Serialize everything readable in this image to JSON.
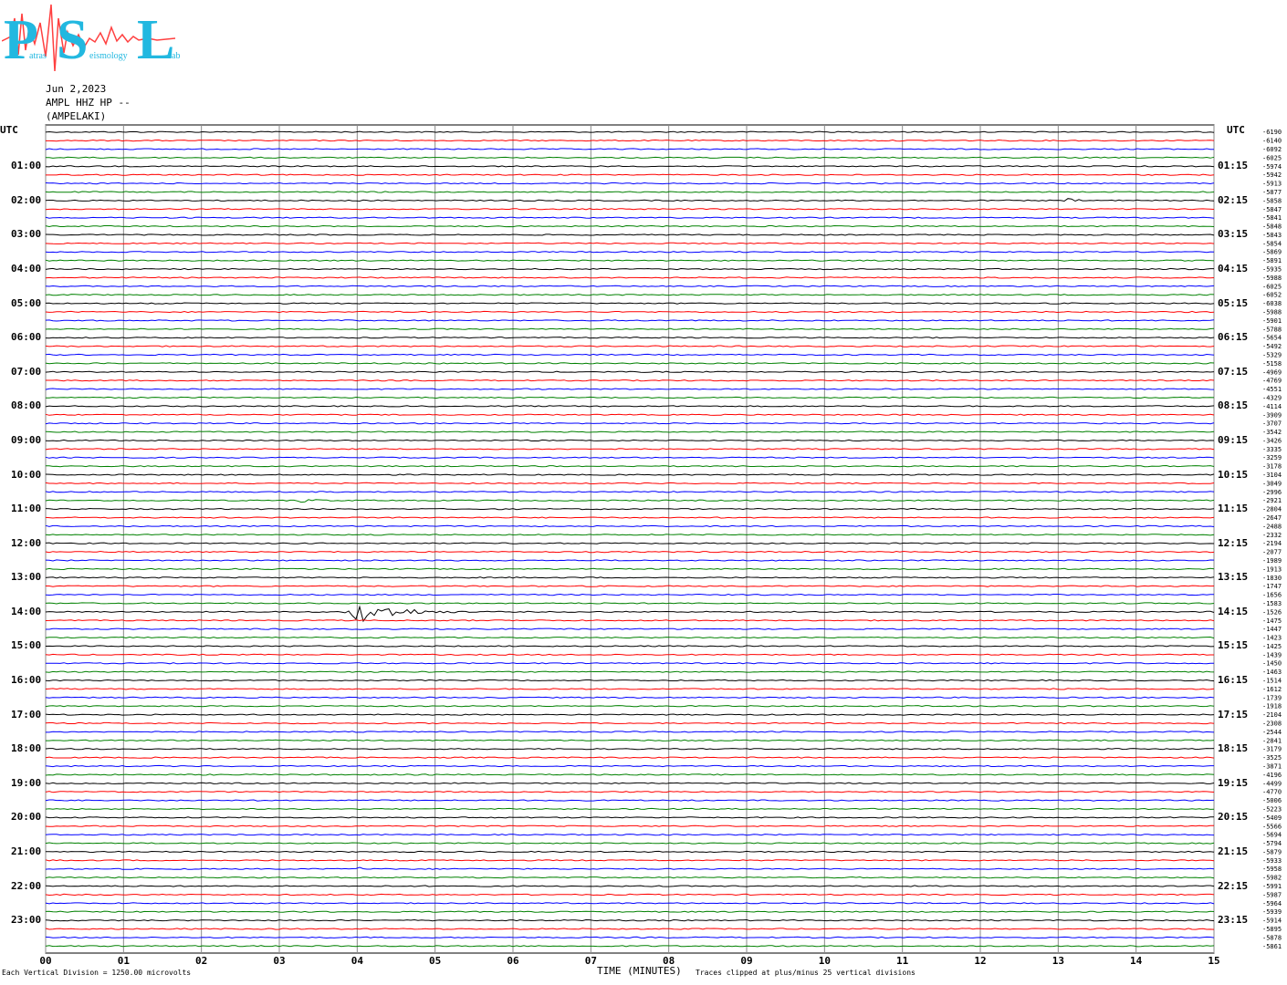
{
  "logo": {
    "text_big": [
      "P",
      "S",
      "L"
    ],
    "text_small": [
      "atras",
      "eismology",
      "ab"
    ]
  },
  "header": {
    "date": "Jun 2,2023",
    "station": "AMPL HHZ HP --",
    "location": "(AMPELAKI)"
  },
  "labels": {
    "utc_left": "UTC",
    "utc_right": "UTC"
  },
  "footer": {
    "division": "Each Vertical Division = 1250.00 microvolts",
    "xlabel": "TIME (MINUTES)",
    "clip": "Traces clipped at plus/minus 25 vertical divisions"
  },
  "chart_data": {
    "type": "line",
    "title": "",
    "xlabel": "TIME (MINUTES)",
    "ylabel": "",
    "xlim": [
      0,
      15
    ],
    "x_ticks": [
      "00",
      "01",
      "02",
      "03",
      "04",
      "05",
      "06",
      "07",
      "08",
      "09",
      "10",
      "11",
      "12",
      "13",
      "14",
      "15"
    ],
    "series_colors": [
      "#000000",
      "#ff0000",
      "#0000ff",
      "#008000"
    ],
    "left_hour_labels": [
      "01:00",
      "02:00",
      "03:00",
      "04:00",
      "05:00",
      "06:00",
      "07:00",
      "08:00",
      "09:00",
      "10:00",
      "11:00",
      "12:00",
      "13:00",
      "14:00",
      "15:00",
      "16:00",
      "17:00",
      "18:00",
      "19:00",
      "20:00",
      "21:00",
      "22:00",
      "23:00"
    ],
    "right_hour_labels": [
      "01:15",
      "02:15",
      "03:15",
      "04:15",
      "05:15",
      "06:15",
      "07:15",
      "08:15",
      "09:15",
      "10:15",
      "11:15",
      "12:15",
      "13:15",
      "14:15",
      "15:15",
      "16:15",
      "17:15",
      "18:15",
      "19:15",
      "20:15",
      "21:15",
      "22:15",
      "23:15"
    ],
    "right_values": [
      "-6190",
      "-6140",
      "-6092",
      "-6025",
      "-5974",
      "-5942",
      "-5913",
      "-5877",
      "-5858",
      "-5847",
      "-5841",
      "-5848",
      "-5843",
      "-5854",
      "-5869",
      "-5891",
      "-5935",
      "-5988",
      "-6025",
      "-6052",
      "-6038",
      "-5988",
      "-5901",
      "-5788",
      "-5654",
      "-5492",
      "-5329",
      "-5158",
      "-4969",
      "-4769",
      "-4551",
      "-4329",
      "-4114",
      "-3909",
      "-3707",
      "-3542",
      "-3426",
      "-3335",
      "-3259",
      "-3178",
      "-3104",
      "-3049",
      "-2996",
      "-2921",
      "-2804",
      "-2647",
      "-2488",
      "-2332",
      "-2194",
      "-2077",
      "-1989",
      "-1913",
      "-1830",
      "-1747",
      "-1656",
      "-1583",
      "-1526",
      "-1475",
      "-1447",
      "-1423",
      "-1425",
      "-1439",
      "-1450",
      "-1463",
      "-1514",
      "-1612",
      "-1739",
      "-1918",
      "-2104",
      "-2308",
      "-2544",
      "-2841",
      "-3179",
      "-3525",
      "-3871",
      "-4196",
      "-4499",
      "-4770",
      "-5006",
      "-5223",
      "-5409",
      "-5566",
      "-5694",
      "-5794",
      "-5879",
      "-5933",
      "-5958",
      "-5982",
      "-5991",
      "-5987",
      "-5964",
      "-5939",
      "-5914",
      "-5895",
      "-5878",
      "-5861"
    ],
    "events": [
      {
        "trace": 8,
        "start_min": 13.0,
        "end_min": 13.6,
        "amplitude": 3
      },
      {
        "trace": 8,
        "start_min": 11.8,
        "end_min": 11.95,
        "amplitude": 2
      },
      {
        "trace": 43,
        "start_min": 3.2,
        "end_min": 3.9,
        "amplitude": 3
      },
      {
        "trace": 56,
        "start_min": 3.8,
        "end_min": 5.5,
        "amplitude": 12
      },
      {
        "trace": 86,
        "start_min": 4.0,
        "end_min": 4.2,
        "amplitude": 2
      }
    ]
  }
}
